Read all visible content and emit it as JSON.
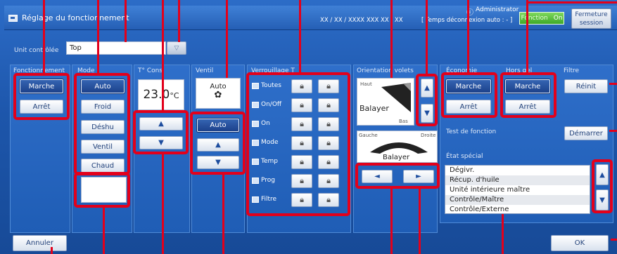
{
  "header": {
    "title": "Réglage du fonctionnement",
    "datetime": "XX / XX / XXXX  XXX  XX : XX",
    "user": "Administrator",
    "logout_info": "[ Temps déconnexion auto : - ]",
    "function_label": "Fonction",
    "function_state": "On",
    "close_label": "Fermeture session"
  },
  "unit": {
    "label": "Unit contrôlée",
    "value": "Top"
  },
  "operation": {
    "label": "Fonctionnement",
    "buttons": [
      "Marche",
      "Arrêt"
    ],
    "selected": "Marche"
  },
  "mode": {
    "label": "Mode",
    "buttons": [
      "Auto",
      "Froid",
      "Déshu",
      "Ventil",
      "Chaud"
    ],
    "selected": "Auto"
  },
  "temperature": {
    "label": "T° Cons",
    "value": "23.0",
    "unit": "°C",
    "up": "▲",
    "down": "▼"
  },
  "fan": {
    "label": "Ventil",
    "display": "Auto",
    "auto_button": "Auto",
    "up": "▲",
    "down": "▼"
  },
  "lock": {
    "label": "Verrouillage T",
    "rows": [
      "Toutes",
      "On/Off",
      "On",
      "Mode",
      "Temp",
      "Prog",
      "Filtre"
    ],
    "lock_icon": "lock-icon"
  },
  "louver": {
    "label": "Orientation volets",
    "top_label": "Haut",
    "bottom_label": "Bas",
    "swing": "Balayer",
    "left_label": "Gauche",
    "right_label": "Droite",
    "swing2": "Balayer",
    "up": "▲",
    "down": "▼",
    "left": "◄",
    "right": "►"
  },
  "economy": {
    "label": "Économie",
    "buttons": [
      "Marche",
      "Arrêt"
    ]
  },
  "frost": {
    "label": "Hors gel",
    "buttons": [
      "Marche",
      "Arrêt"
    ]
  },
  "filter": {
    "label": "Filtre",
    "reset": "Réinit"
  },
  "test": {
    "label": "Test de fonction",
    "button": "Démarrer"
  },
  "special": {
    "label": "État spécial",
    "items": [
      "Dégivr.",
      "Récup. d'huile",
      "Unité intérieure maître",
      "Contrôle/Maître",
      "Contrôle/Externe"
    ],
    "up": "▲",
    "down": "▼"
  },
  "footer": {
    "cancel": "Annuler",
    "ok": "OK"
  },
  "colors": {
    "annotation": "#e3001b",
    "background": "#1d56ab",
    "selected": "#1c418b"
  }
}
